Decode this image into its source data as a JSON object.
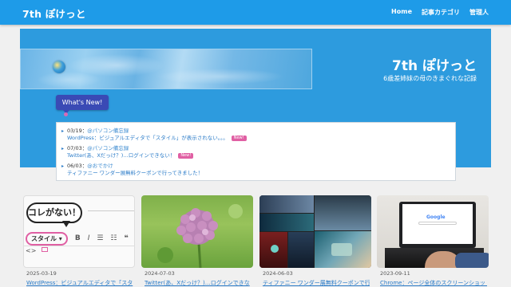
{
  "header": {
    "site_title": "7th ぽけっと",
    "nav": [
      "Home",
      "記事カテゴリ",
      "管理人"
    ]
  },
  "hero": {
    "title": "7th ぽけっと",
    "subtitle": "6歳差姉妹の母のきまぐれな記録"
  },
  "whats_new": {
    "button_label": "What's New!",
    "items": [
      {
        "date": "03/19",
        "sep": "：",
        "category": "@パソコン備忘録",
        "title": "WordPress：ビジュアルエディタで「スタイル」が表示されない。。。",
        "badge": "New!"
      },
      {
        "date": "07/03",
        "sep": "：",
        "category": "@パソコン備忘録",
        "title": "Twitter(あ、Xだっけ？)…ログインできない！",
        "badge": "New!"
      },
      {
        "date": "06/03",
        "sep": "：",
        "category": "@おでかけ",
        "title": "ティファニー ワンダー展無料クーポンで行ってきました！",
        "badge": ""
      }
    ]
  },
  "cards": [
    {
      "date": "2025-03-19",
      "title": "WordPress：ビジュアルエディタで「スタ",
      "thumb_text": "コレがない！",
      "style_label": "スタイル ▾"
    },
    {
      "date": "2024-07-03",
      "title": "Twitter(あ、Xだっけ？)…ログインできな"
    },
    {
      "date": "2024-06-03",
      "title": "ティファニー ワンダー展無料クーポンで行"
    },
    {
      "date": "2023-09-11",
      "title": "Chrome：ページ全体のスクリーンショット",
      "thumb_text": "Google"
    }
  ],
  "colors": {
    "nav_bg": "#1e9be8",
    "hero_bg": "#2d9bde",
    "button_bg": "#3a4ab5",
    "badge_bg": "#e05fa3",
    "link": "#2a7bc8"
  }
}
